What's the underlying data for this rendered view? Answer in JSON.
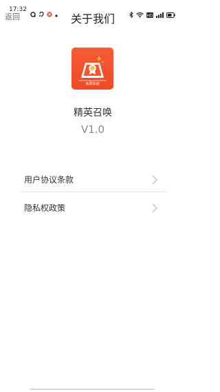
{
  "status_bar": {
    "time": "17:32",
    "left_icons": [
      "q-icon",
      "ear-icon",
      "app-badge-icon",
      "dot-icon"
    ],
    "right_icons": [
      "bluetooth-icon",
      "wifi-icon",
      "hd-icon",
      "signal-icon",
      "battery-icon"
    ]
  },
  "nav": {
    "back_label": "返回",
    "title": "关于我们"
  },
  "app": {
    "logo_caption": "免费实战",
    "name": "精英召唤",
    "version": "V1.0"
  },
  "menu": {
    "items": [
      {
        "label": "用户协议条款",
        "icon": "chevron-right-icon"
      },
      {
        "label": "隐私权政策",
        "icon": "chevron-right-icon"
      }
    ]
  },
  "colors": {
    "logo_orange": "#f25530",
    "accent_gold": "#f6c04a"
  }
}
